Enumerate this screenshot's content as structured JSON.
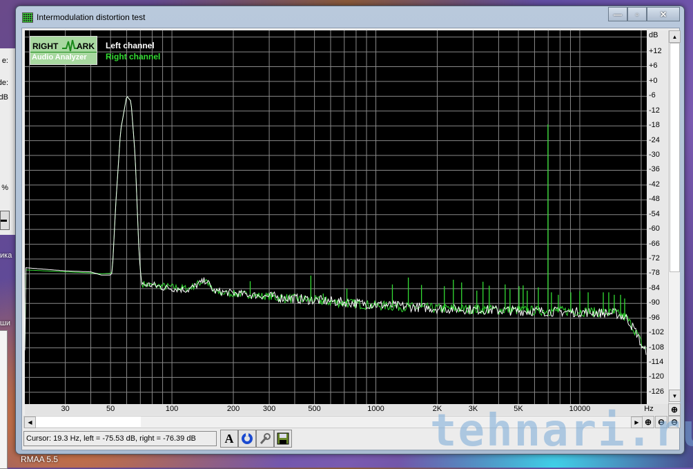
{
  "background_window": {
    "labels": [
      "e:",
      "de:",
      "dB",
      "%"
    ],
    "desktop_labels": [
      "ика",
      "ши"
    ]
  },
  "window": {
    "title": "Intermodulation distortion test",
    "minimize": "—",
    "maximize": "▫",
    "close": "✕"
  },
  "logo": {
    "line1a": "RIGHT",
    "line1b": "ARK",
    "line2": "Audio Analyzer"
  },
  "legend": {
    "left": "Left channel",
    "right": "Right channel"
  },
  "colors": {
    "left": "#ffffff",
    "right": "#33dd33",
    "grid": "#8a8a8a",
    "plot_bg": "#000000"
  },
  "status": {
    "cursor": "Cursor:  19.3 Hz,  left = -75.53 dB,  right = -76.39 dB"
  },
  "toolbar": {
    "font_btn": "A"
  },
  "watermark": "tehnari.ru",
  "taskbar_label": "RMAA 5.5",
  "chart_data": {
    "type": "line",
    "title": "Intermodulation distortion test",
    "xlabel": "Hz",
    "ylabel": "dB",
    "xscale": "log",
    "xlim": [
      19,
      21300
    ],
    "ylim": [
      -130.8,
      20.7
    ],
    "y_ticks": [
      "+12",
      "+6",
      "+0",
      "-6",
      "-12",
      "-18",
      "-24",
      "-30",
      "-36",
      "-42",
      "-48",
      "-54",
      "-60",
      "-66",
      "-72",
      "-78",
      "-84",
      "-90",
      "-96",
      "-102",
      "-108",
      "-114",
      "-120",
      "-126"
    ],
    "y_unit_label": "dB",
    "x_ticks": [
      {
        "v": 30,
        "l": "30"
      },
      {
        "v": 50,
        "l": "50"
      },
      {
        "v": 100,
        "l": "100"
      },
      {
        "v": 200,
        "l": "200"
      },
      {
        "v": 300,
        "l": "300"
      },
      {
        "v": 500,
        "l": "500"
      },
      {
        "v": 1000,
        "l": "1000"
      },
      {
        "v": 2000,
        "l": "2K"
      },
      {
        "v": 3000,
        "l": "3K"
      },
      {
        "v": 5000,
        "l": "5K"
      },
      {
        "v": 10000,
        "l": "10000"
      }
    ],
    "x_unit_label": "Hz",
    "grid": true,
    "legend_placement": "top-left",
    "series": [
      {
        "name": "Left channel",
        "points": [
          [
            19,
            -75.5
          ],
          [
            30,
            -76.8
          ],
          [
            40,
            -77.2
          ],
          [
            45,
            -78.5
          ],
          [
            50,
            -78.5
          ],
          [
            51,
            -77.5
          ],
          [
            53,
            -50
          ],
          [
            56,
            -20
          ],
          [
            60,
            -5.9
          ],
          [
            63,
            -8
          ],
          [
            66,
            -30
          ],
          [
            69,
            -70
          ],
          [
            71,
            -82.3
          ],
          [
            80,
            -82.5
          ],
          [
            90,
            -83.5
          ],
          [
            120,
            -84.5
          ],
          [
            147,
            -80.5
          ],
          [
            160,
            -85
          ],
          [
            242,
            -86.5
          ],
          [
            400,
            -88
          ],
          [
            700,
            -89.5
          ],
          [
            1000,
            -90.5
          ],
          [
            2000,
            -92
          ],
          [
            5000,
            -93
          ],
          [
            10000,
            -93.5
          ],
          [
            15000,
            -94
          ],
          [
            17000,
            -96
          ],
          [
            19000,
            -102
          ],
          [
            20500,
            -109
          ]
        ]
      },
      {
        "name": "Right channel",
        "points": [
          [
            19,
            -76.4
          ],
          [
            30,
            -77.2
          ],
          [
            40,
            -77.6
          ],
          [
            45,
            -78
          ],
          [
            50,
            -77.8
          ],
          [
            51,
            -77
          ],
          [
            53,
            -50
          ],
          [
            56,
            -20
          ],
          [
            60,
            -5.9
          ],
          [
            63,
            -8
          ],
          [
            66,
            -30
          ],
          [
            69,
            -70
          ],
          [
            71,
            -82
          ],
          [
            80,
            -82.8
          ],
          [
            90,
            -83
          ],
          [
            120,
            -84
          ],
          [
            147,
            -80.4
          ],
          [
            160,
            -85.5
          ],
          [
            242,
            -86.5
          ],
          [
            400,
            -88.2
          ],
          [
            700,
            -89.8
          ],
          [
            1000,
            -90.8
          ],
          [
            2000,
            -92
          ],
          [
            5000,
            -92.8
          ],
          [
            10000,
            -93.2
          ],
          [
            15000,
            -94
          ],
          [
            17000,
            -96
          ],
          [
            19000,
            -102
          ],
          [
            20500,
            -108
          ]
        ]
      }
    ],
    "spikes_hz_db": [
      [
        242,
        -81
      ],
      [
        480,
        -78.7
      ],
      [
        552,
        -86
      ],
      [
        721,
        -84
      ],
      [
        1205,
        -82.3
      ],
      [
        1443,
        -79.5
      ],
      [
        1674,
        -82.5
      ],
      [
        2167,
        -83
      ],
      [
        2399,
        -80.4
      ],
      [
        2633,
        -81.5
      ],
      [
        3126,
        -84.8
      ],
      [
        3352,
        -81.2
      ],
      [
        3597,
        -82.8
      ],
      [
        4305,
        -82.3
      ],
      [
        4547,
        -84.2
      ],
      [
        5034,
        -83
      ],
      [
        5275,
        -82.7
      ],
      [
        5525,
        -84.8
      ],
      [
        6261,
        -83.5
      ],
      [
        6980,
        -17.4
      ],
      [
        7260,
        -85.5
      ],
      [
        7848,
        -86.5
      ],
      [
        9035,
        -85.5
      ],
      [
        10000,
        -85
      ],
      [
        10990,
        -85.5
      ],
      [
        13040,
        -85.5
      ],
      [
        13870,
        -85.5
      ],
      [
        14760,
        -86.5
      ],
      [
        15850,
        -86.5
      ],
      [
        16600,
        -88
      ]
    ]
  }
}
